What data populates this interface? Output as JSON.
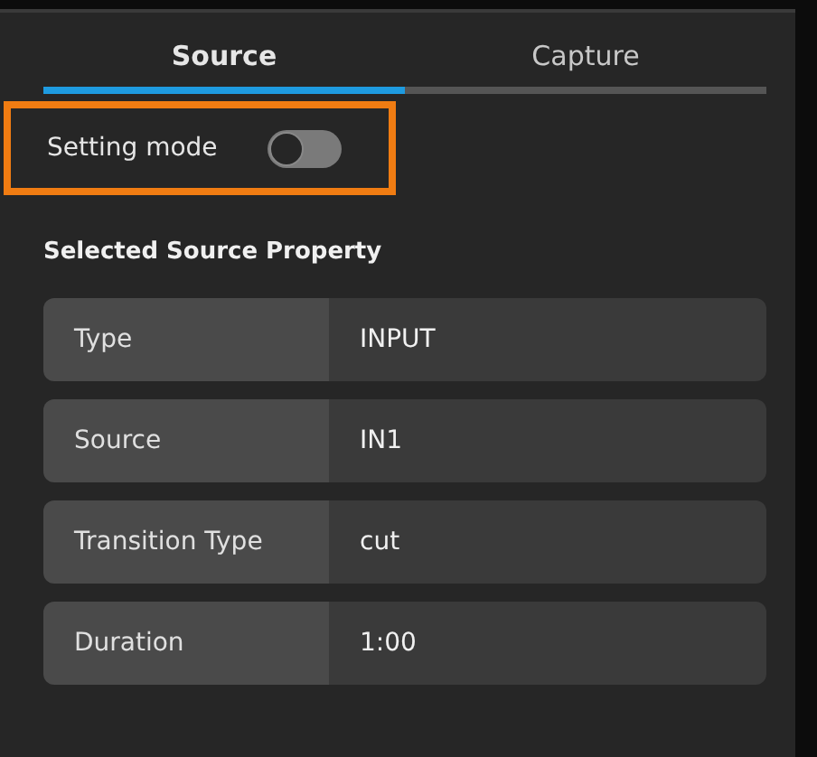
{
  "tabs": [
    {
      "label": "Source",
      "selected": true
    },
    {
      "label": "Capture",
      "selected": false
    }
  ],
  "setting_mode": {
    "label": "Setting mode",
    "on": false,
    "highlighted": true
  },
  "section_title": "Selected Source Property",
  "properties": [
    {
      "label": "Type",
      "value": "INPUT"
    },
    {
      "label": "Source",
      "value": "IN1"
    },
    {
      "label": "Transition Type",
      "value": "cut"
    },
    {
      "label": "Duration",
      "value": "1:00"
    }
  ]
}
